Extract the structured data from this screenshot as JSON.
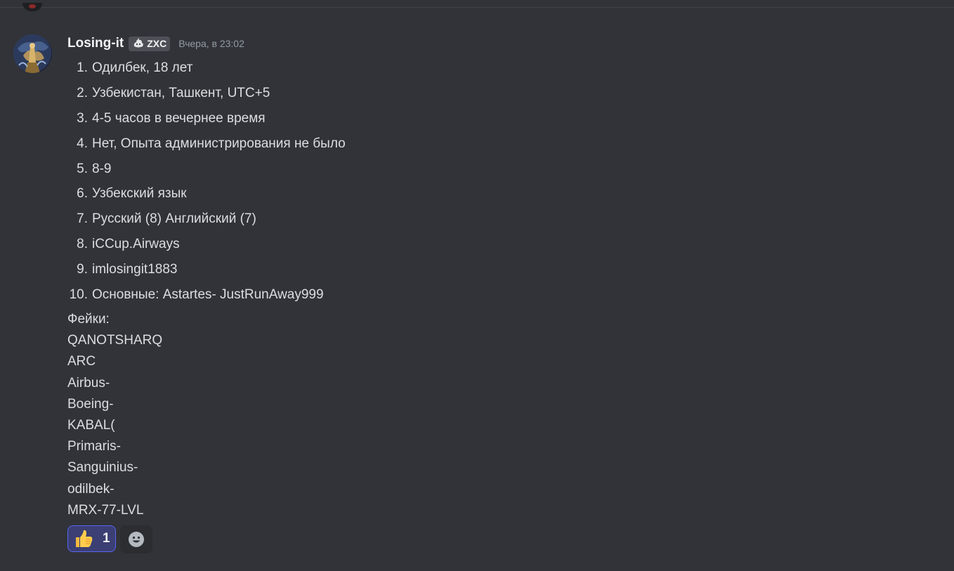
{
  "message": {
    "author": "Losing-it",
    "clan_tag": "ZXC",
    "timestamp": "Вчера, в 23:02",
    "list": [
      {
        "num": "1.",
        "text": "Одилбек, 18 лет"
      },
      {
        "num": "2.",
        "text": "Узбекистан, Ташкент, UTC+5"
      },
      {
        "num": "3.",
        "text": "4-5 часов в вечернее время"
      },
      {
        "num": "4.",
        "text": "Нет, Опыта администрирования не было"
      },
      {
        "num": "5.",
        "text": "8-9"
      },
      {
        "num": "6.",
        "text": "Узбекский язык"
      },
      {
        "num": "7.",
        "text": "Русский (8) Английский (7)"
      },
      {
        "num": "8.",
        "text": "iCCup.Airways"
      },
      {
        "num": "9.",
        "text": "imlosingit1883"
      },
      {
        "num": "10.",
        "text": "Основные: Astartes- JustRunAway999"
      }
    ],
    "fakes": [
      "Фейки:",
      "QANOTSHARQ",
      "ARC",
      "Airbus-",
      "Boeing-",
      "KABAL(",
      "Primaris-",
      "Sanguinius-",
      "odilbek-",
      "MRX-77-LVL"
    ],
    "reactions": [
      {
        "emoji": "thumbs-up-icon",
        "count": "1"
      }
    ],
    "add_reaction_icon": "smiley-add-icon"
  },
  "colors": {
    "background": "#313338",
    "text": "#dbdee1",
    "username": "#f2f3f5",
    "timestamp": "#949ba4",
    "reaction_border": "#5865f2",
    "reaction_bg": "#3b3f73",
    "tag_bg": "#4e5058"
  }
}
